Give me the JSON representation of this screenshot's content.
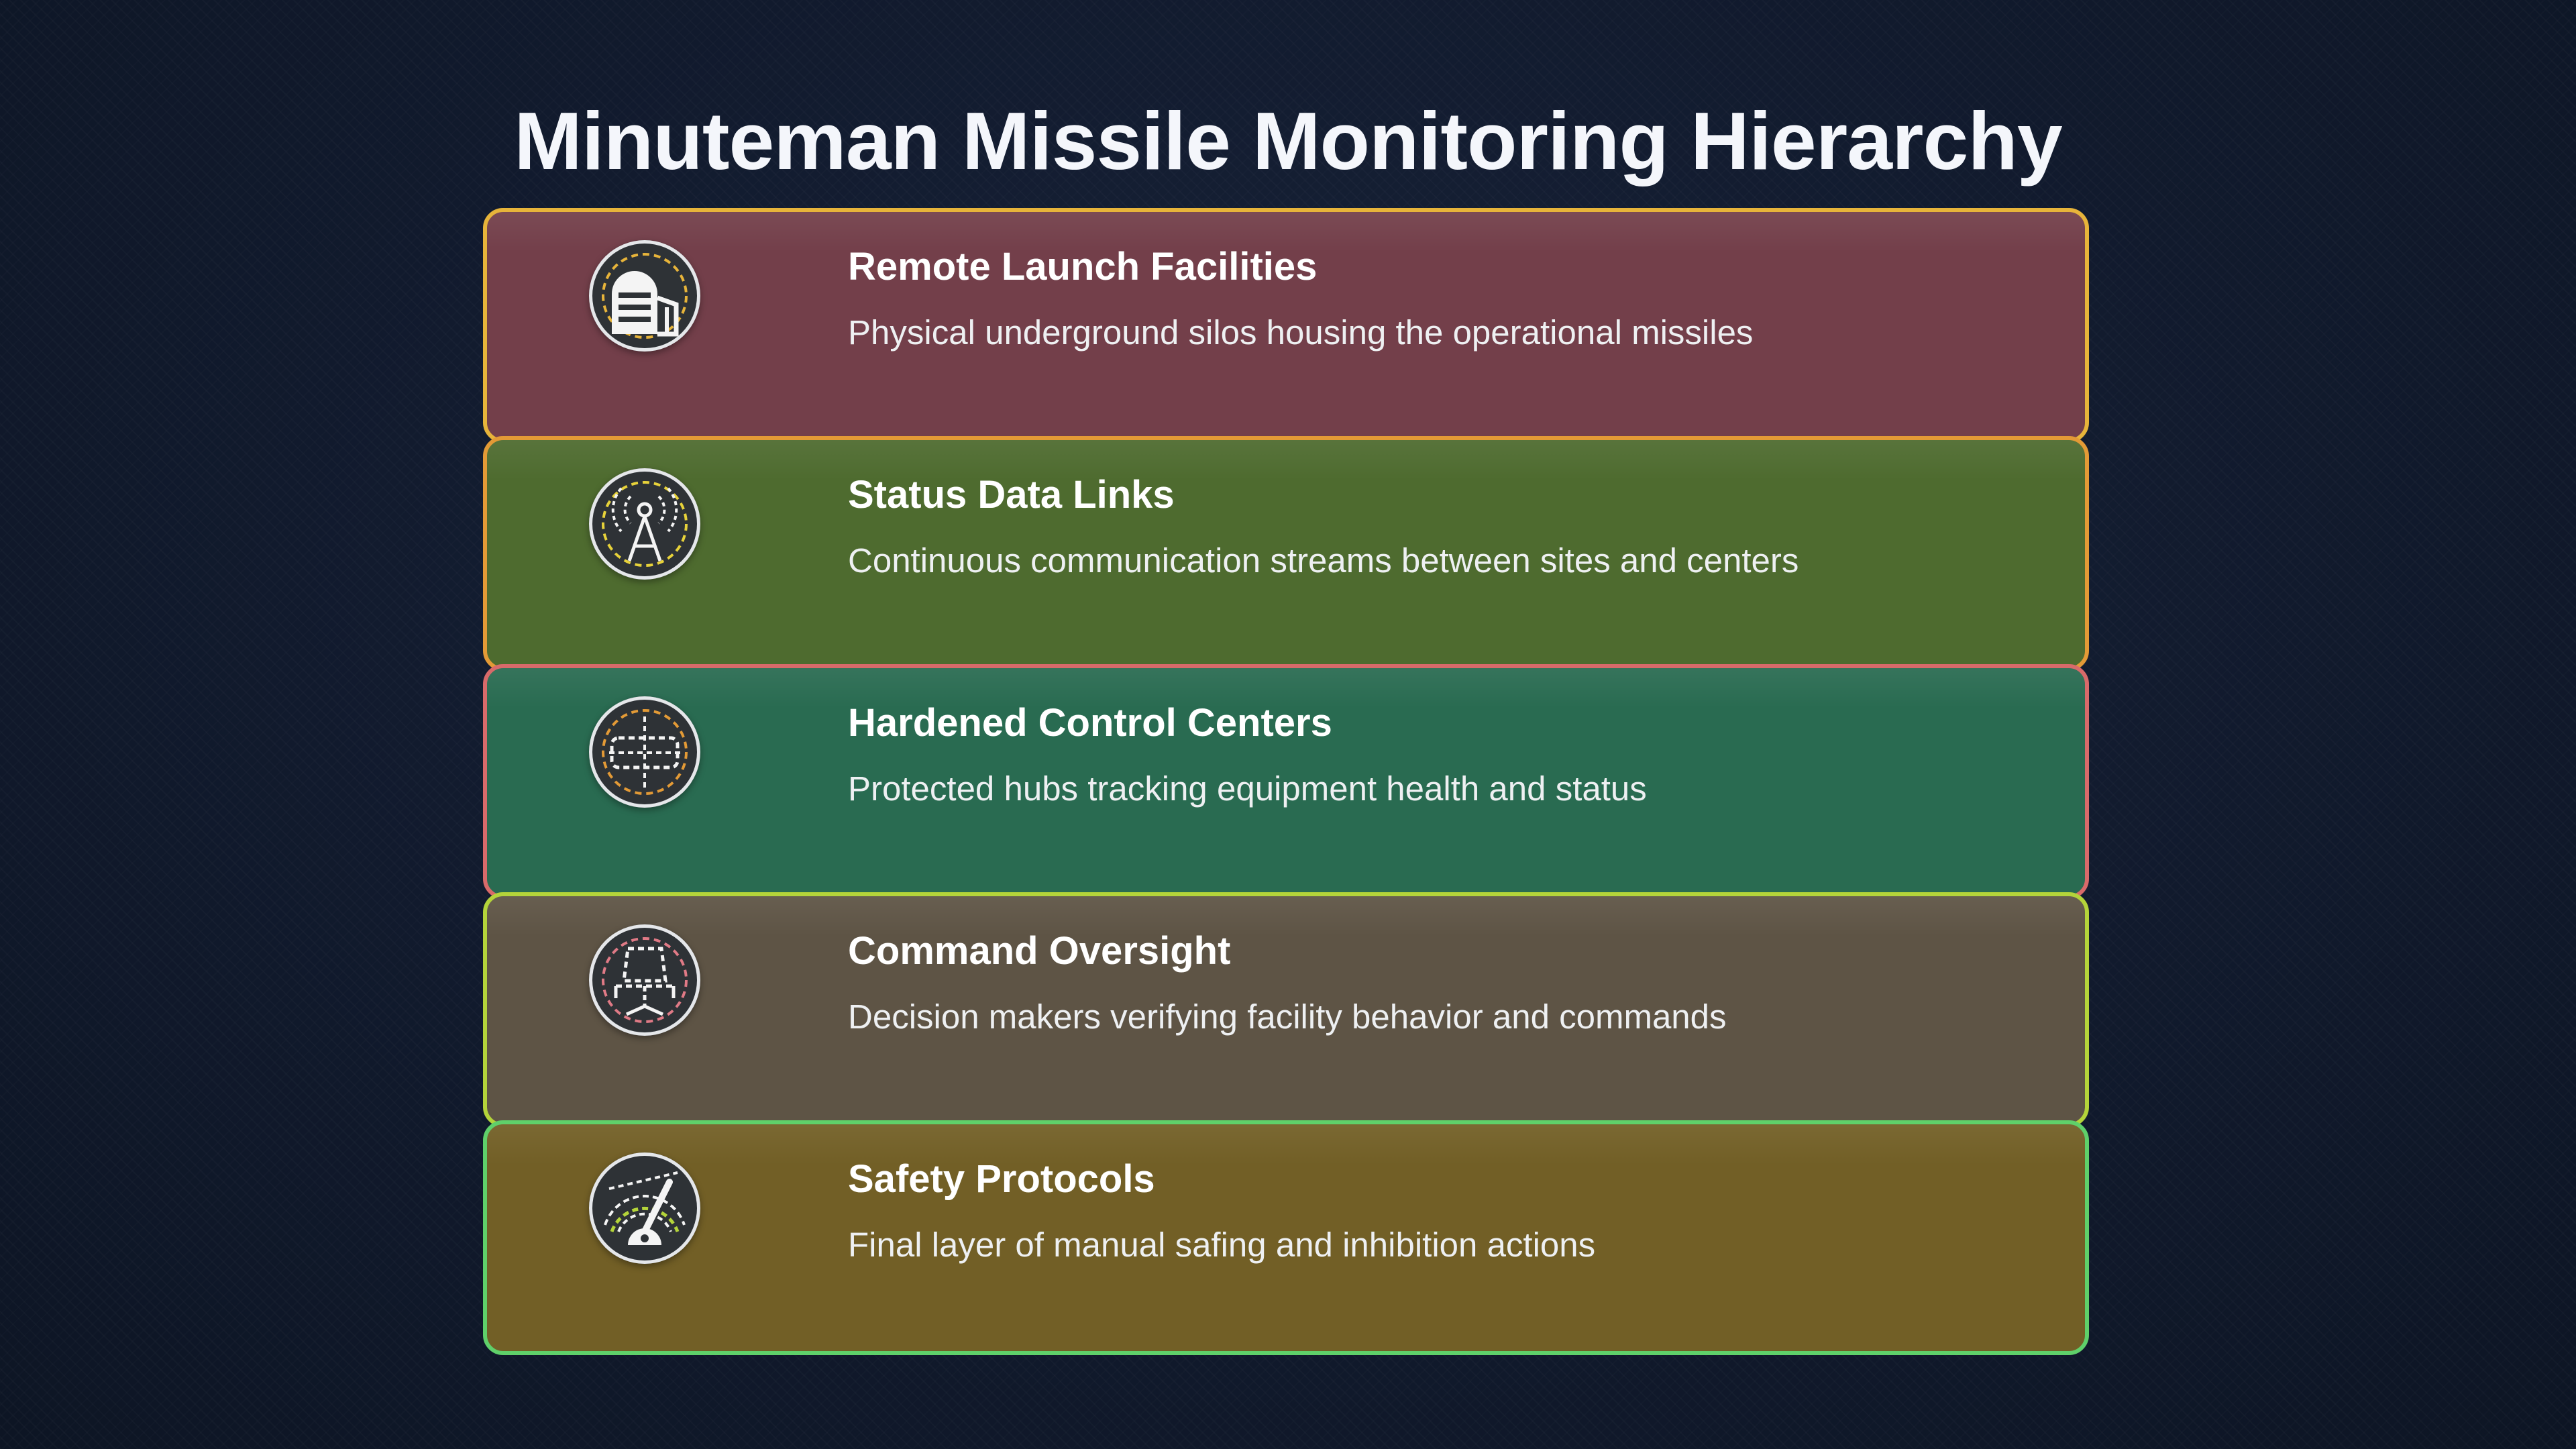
{
  "title": "Minuteman Missile Monitoring Hierarchy",
  "layers": [
    {
      "title": "Remote Launch Facilities",
      "description": "Physical underground silos housing the operational missiles",
      "icon": "silo-icon",
      "fill": "#733f4a",
      "border": "#e7b43a"
    },
    {
      "title": "Status Data Links",
      "description": "Continuous communication streams between sites and centers",
      "icon": "antenna-tower-icon",
      "fill": "#4e6b2f",
      "border": "#e39a36"
    },
    {
      "title": "Hardened Control Centers",
      "description": "Protected hubs tracking equipment health and status",
      "icon": "control-center-icon",
      "fill": "#296b51",
      "border": "#d86a6a"
    },
    {
      "title": "Command Oversight",
      "description": "Decision makers verifying facility behavior and commands",
      "icon": "command-chair-icon",
      "fill": "#5e5445",
      "border": "#b4d43a"
    },
    {
      "title": "Safety Protocols",
      "description": "Final layer of manual safing and inhibition actions",
      "icon": "safety-gauge-icon",
      "fill": "#725f26",
      "border": "#5fd06a"
    }
  ]
}
